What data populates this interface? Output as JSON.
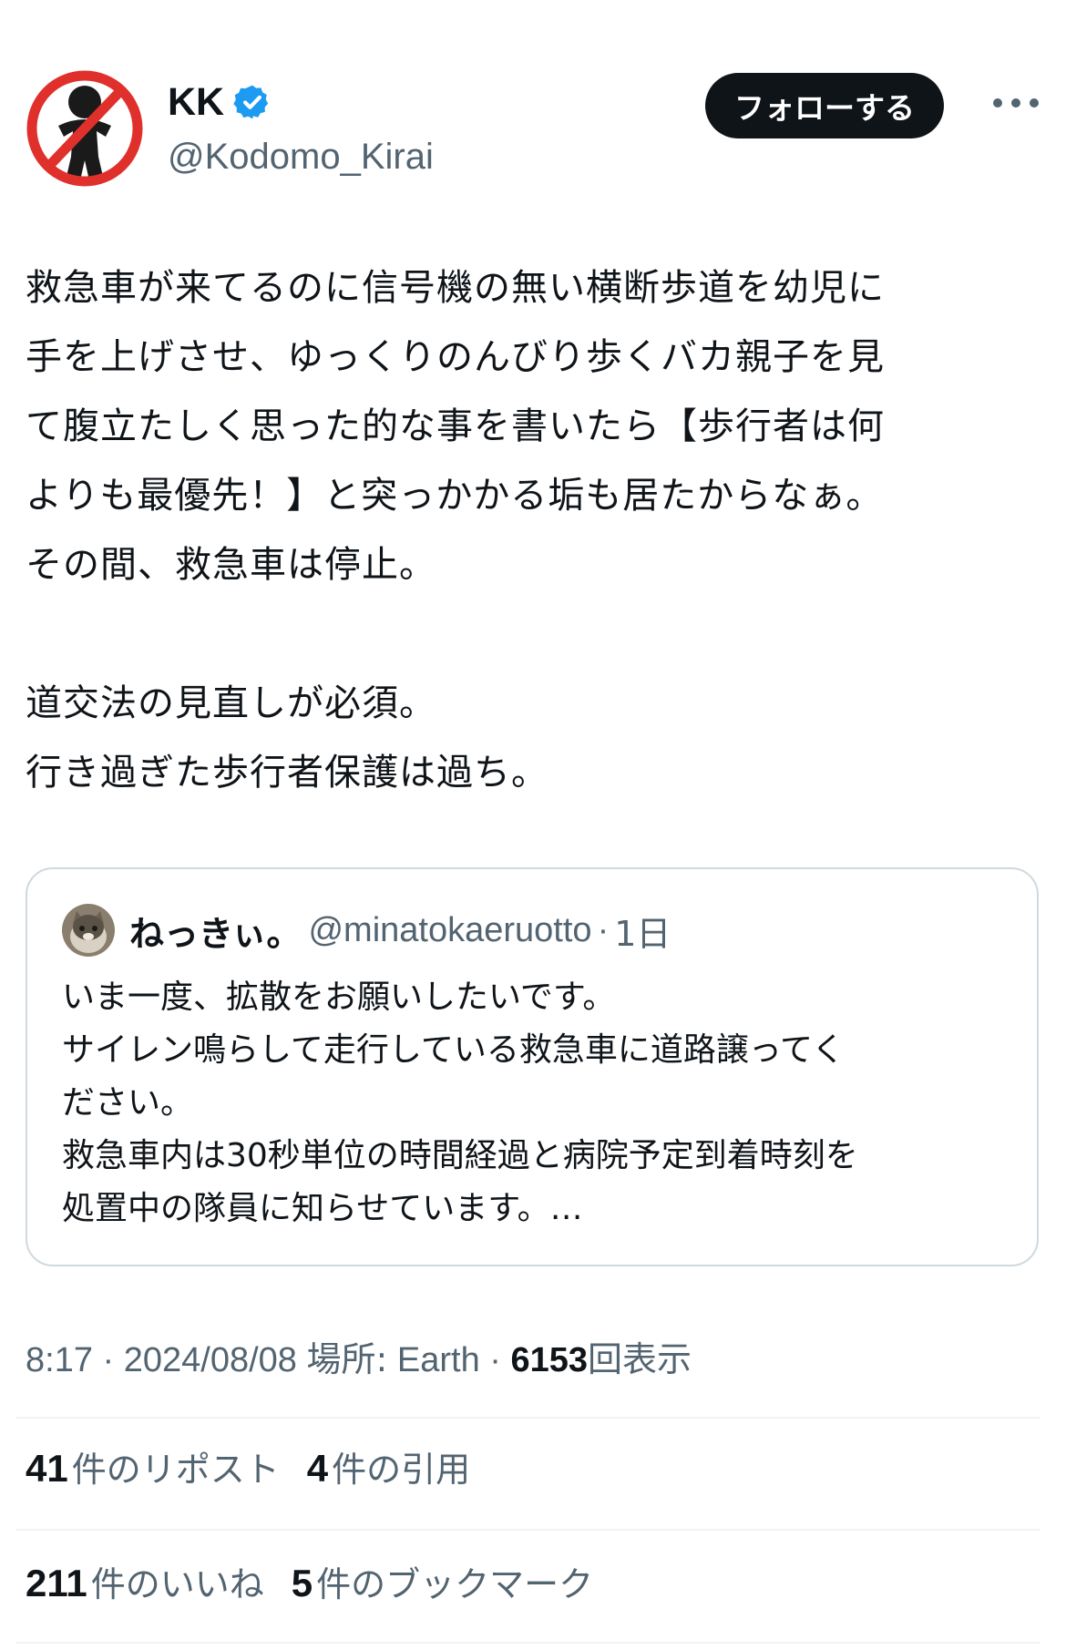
{
  "author": {
    "display_name": "KK",
    "handle": "@Kodomo_Kirai",
    "avatar_icon": "no-children-icon",
    "verified_icon": "verified-badge-icon",
    "verified_color": "#1d9bf0"
  },
  "actions": {
    "follow_label": "フォローする",
    "more_icon": "more-options-icon"
  },
  "tweet": {
    "text": "救急車が来てるのに信号機の無い横断歩道を幼児に\n手を上げさせ、ゆっくりのんびり歩くバカ親子を見\nて腹立たしく思った的な事を書いたら【歩行者は何\nよりも最優先！】と突っかかる垢も居たからなぁ。\nその間、救急車は停止。\n\n道交法の見直しが必須。\n行き過ぎた歩行者保護は過ち。"
  },
  "quote": {
    "display_name": "ねっきぃ。",
    "handle": "@minatokaeruotto",
    "separator": "·",
    "time": "1日",
    "text": "いま一度、拡散をお願いしたいです。\nサイレン鳴らして走行している救急車に道路譲ってく\nださい。\n救急車内は30秒単位の時間経過と病院予定到着時刻を\n処置中の隊員に知らせています。…"
  },
  "meta": {
    "time": "8:17",
    "sep1": "·",
    "date": "2024/08/08",
    "location_label": "場所:",
    "location": "Earth",
    "sep2": "·",
    "views_count": "6153",
    "views_label": "回表示"
  },
  "stats": {
    "reposts_count": "41",
    "reposts_label": "件のリポスト",
    "quotes_count": "4",
    "quotes_label": "件の引用",
    "likes_count": "211",
    "likes_label": "件のいいね",
    "bookmarks_count": "5",
    "bookmarks_label": "件のブックマーク"
  },
  "colors": {
    "text_primary": "#0f1419",
    "text_secondary": "#536471",
    "border": "#cfd9de",
    "prohibition_red": "#e0302c"
  }
}
